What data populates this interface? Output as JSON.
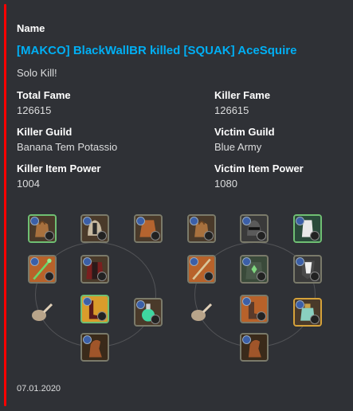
{
  "embed": {
    "accent_color": "#ff0000",
    "name_label": "Name",
    "title": "[MAKCO] BlackWallBR killed [SQUAK] AceSquire",
    "description": "Solo Kill!",
    "fields": [
      {
        "name": "Total Fame",
        "value": "126615"
      },
      {
        "name": "Killer Fame",
        "value": "126615"
      },
      {
        "name": "Killer Guild",
        "value": "Banana Tem Potassio"
      },
      {
        "name": "Victim Guild",
        "value": "Blue Army"
      },
      {
        "name": "Killer Item Power",
        "value": "1004"
      },
      {
        "name": "Victim Item Power",
        "value": "1080"
      }
    ],
    "footer": "07.01.2020"
  },
  "killer_gear": {
    "slots": [
      "bag",
      "helmet",
      "cape",
      "main-hand",
      "chest",
      "off-hand",
      "food",
      "shoes",
      "potion",
      "mount"
    ]
  },
  "victim_gear": {
    "slots": [
      "bag",
      "helmet",
      "cape",
      "main-hand",
      "chest",
      "off-hand",
      "food",
      "shoes",
      "potion",
      "mount"
    ]
  }
}
